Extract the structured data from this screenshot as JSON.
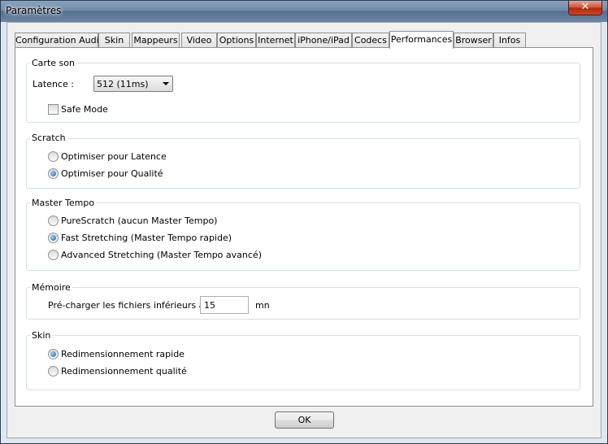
{
  "window": {
    "title": "Paramètres",
    "close_glyph": "✕"
  },
  "tabs": [
    {
      "label": "Configuration Audio"
    },
    {
      "label": "Skin"
    },
    {
      "label": "Mappeurs"
    },
    {
      "label": "Video"
    },
    {
      "label": "Options"
    },
    {
      "label": "Internet"
    },
    {
      "label": "iPhone/iPad"
    },
    {
      "label": "Codecs"
    },
    {
      "label": "Performances",
      "active": true
    },
    {
      "label": "Browser"
    },
    {
      "label": "Infos"
    }
  ],
  "carte_son": {
    "title": "Carte son",
    "latence_label": "Latence :",
    "latence_value": "512 (11ms)",
    "safe_mode_label": "Safe Mode",
    "safe_mode_checked": false
  },
  "scratch": {
    "title": "Scratch",
    "options": [
      "Optimiser pour Latence",
      "Optimiser pour Qualité"
    ],
    "selected": 1
  },
  "master_tempo": {
    "title": "Master Tempo",
    "options": [
      "PureScratch (aucun Master Tempo)",
      "Fast Stretching (Master Tempo rapide)",
      "Advanced Stretching (Master Tempo avancé)"
    ],
    "selected": 1
  },
  "memoire": {
    "title": "Mémoire",
    "preload_label": "Pré-charger les fichiers inférieurs à :",
    "preload_value": "15",
    "unit": "mn"
  },
  "skin": {
    "title": "Skin",
    "options": [
      "Redimensionnement rapide",
      "Redimensionnement qualité"
    ],
    "selected": 0
  },
  "footer": {
    "ok_label": "OK"
  }
}
